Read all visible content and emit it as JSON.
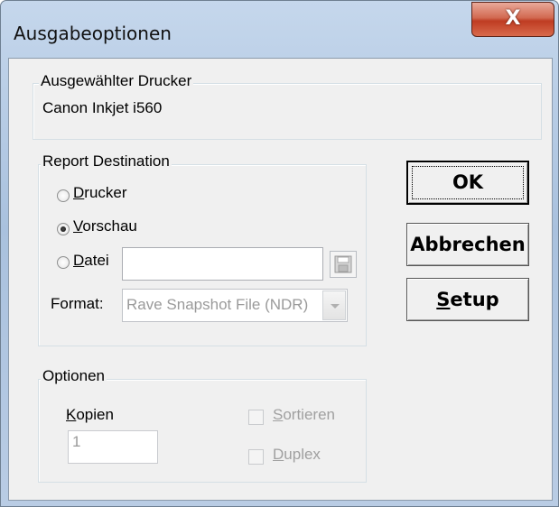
{
  "window": {
    "title": "Ausgabeoptionen",
    "close_label": "X"
  },
  "printer_group": {
    "legend": "Ausgewählter Drucker",
    "printer_name": "Canon Inkjet i560"
  },
  "destination_group": {
    "legend": "Report Destination",
    "options": [
      {
        "label": "Drucker",
        "mnemonic": "D",
        "selected": false
      },
      {
        "label": "Vorschau",
        "mnemonic": "V",
        "selected": true
      },
      {
        "label": "Datei",
        "mnemonic": "D",
        "selected": false
      }
    ],
    "file_value": "",
    "format_label": "Format:",
    "format_value": "Rave Snapshot File (NDR)"
  },
  "options_group": {
    "legend": "Optionen",
    "copies_label": "Kopien",
    "copies_value": "1",
    "sort_label": "Sortieren",
    "duplex_label": "Duplex"
  },
  "buttons": {
    "ok": "OK",
    "cancel": "Abbrechen",
    "setup": "Setup"
  },
  "icons": {
    "close": "close-icon",
    "save": "floppy-disk-icon",
    "dropdown": "chevron-down-icon"
  }
}
